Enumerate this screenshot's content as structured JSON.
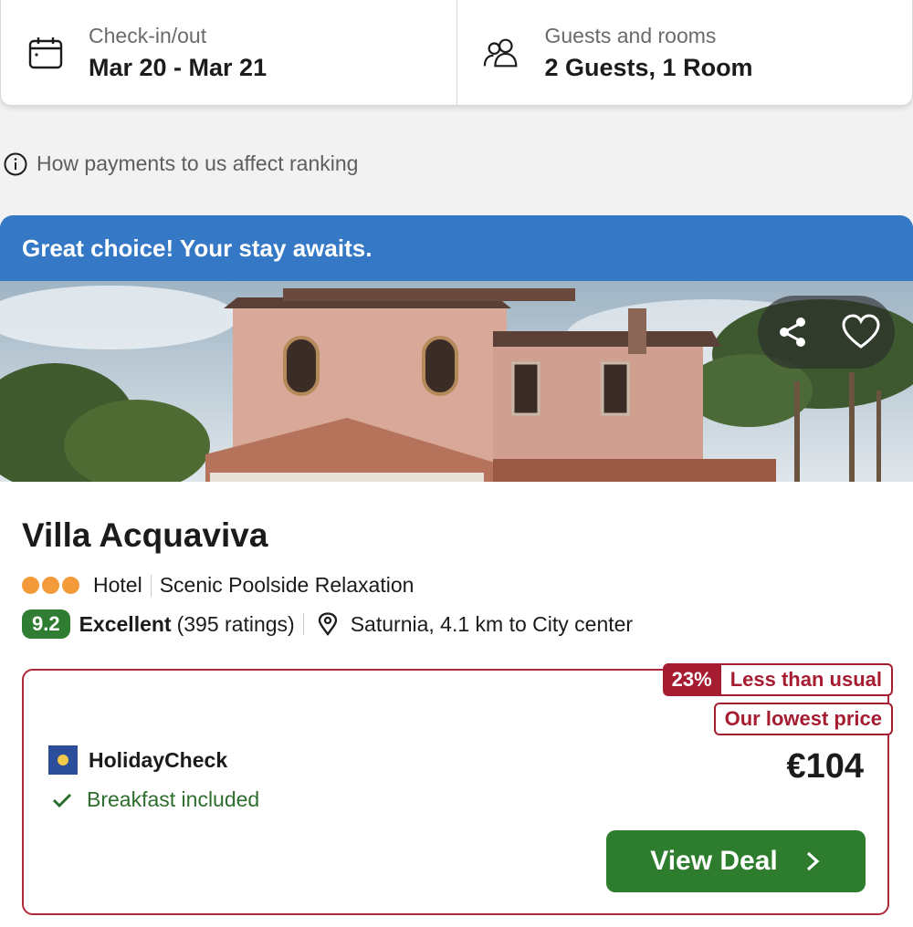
{
  "search": {
    "checkin_label": "Check-in/out",
    "checkin_value": "Mar 20 - Mar 21",
    "guests_label": "Guests and rooms",
    "guests_value": "2 Guests, 1 Room"
  },
  "ranking_note": "How payments to us affect ranking",
  "card": {
    "banner": "Great choice! Your stay awaits.",
    "hotel_name": "Villa Acquaviva",
    "star_count": 3,
    "type": "Hotel",
    "tagline": "Scenic Poolside Relaxation",
    "score": "9.2",
    "rating_word": "Excellent",
    "rating_count": "(395 ratings)",
    "location": "Saturnia, 4.1 km to City center",
    "deal": {
      "discount_pct": "23%",
      "discount_text": "Less than usual",
      "lowest_badge": "Our lowest price",
      "provider": "HolidayCheck",
      "perk": "Breakfast included",
      "price": "€104",
      "cta": "View Deal"
    }
  },
  "icons": {
    "calendar": "calendar-icon",
    "guests": "users-icon",
    "info": "info-icon",
    "share": "share-icon",
    "favorite": "heart-icon",
    "location": "map-pin-icon",
    "check": "check-icon",
    "chevron": "chevron-right-icon"
  },
  "colors": {
    "banner": "#3478c6",
    "score_badge": "#2e7d32",
    "deal_accent": "#a61d32",
    "cta": "#2e7d2e",
    "star_dot": "#f39a3a"
  }
}
